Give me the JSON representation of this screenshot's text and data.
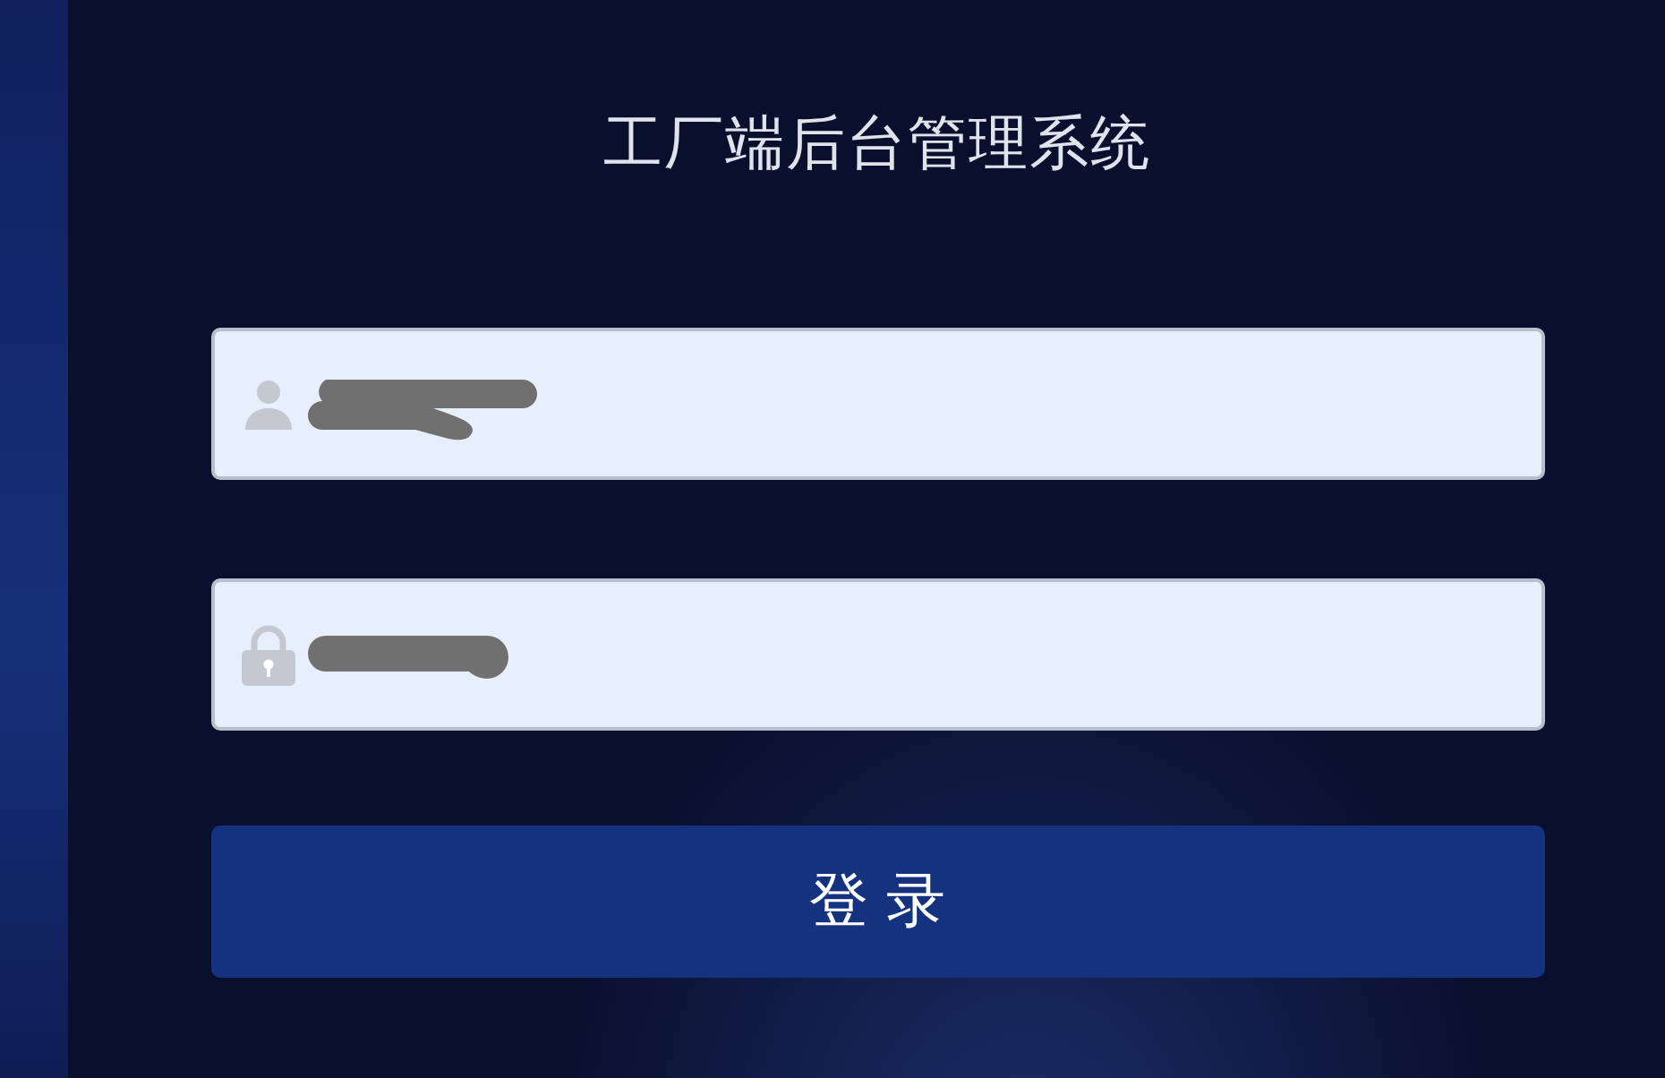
{
  "title": "工厂端后台管理系统",
  "fields": [
    {
      "kind": "user"
    },
    {
      "kind": "password"
    }
  ],
  "login_button": {
    "label": "登 录"
  }
}
